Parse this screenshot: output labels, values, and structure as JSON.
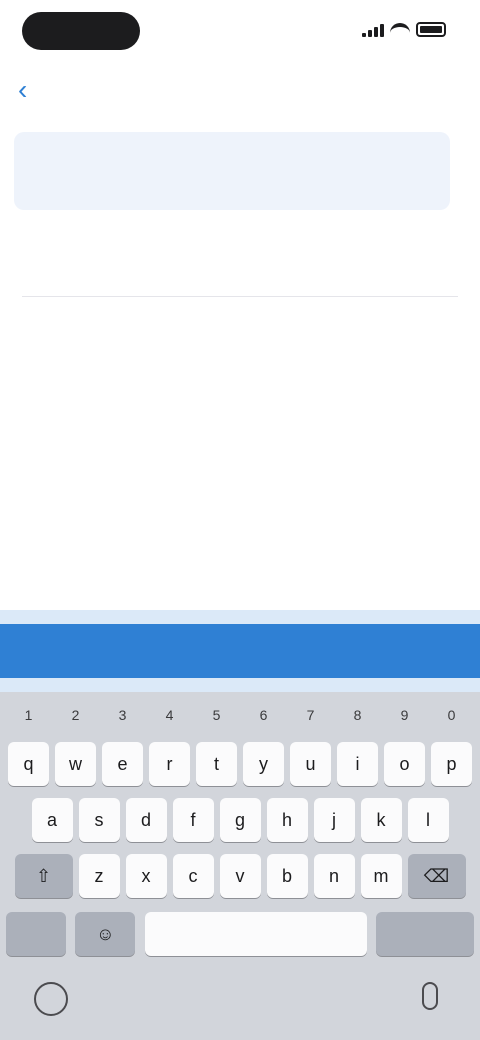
{
  "nav": {
    "back_icon": "chevron-left-icon",
    "title": ""
  },
  "form": {
    "header_label": "",
    "header_value": "",
    "input_value": "",
    "hint_text": ""
  },
  "action": {
    "label": ""
  },
  "keyboard": {
    "number_row": [
      "1",
      "2",
      "3",
      "4",
      "5",
      "6",
      "7",
      "8",
      "9",
      "0"
    ],
    "row1": [
      "q",
      "w",
      "e",
      "r",
      "t",
      "y",
      "u",
      "i",
      "o",
      "p"
    ],
    "row2": [
      "a",
      "s",
      "d",
      "f",
      "g",
      "h",
      "j",
      "k",
      "l"
    ],
    "row3": [
      "z",
      "x",
      "c",
      "v",
      "b",
      "n",
      "m"
    ],
    "shift_icon": "shift-icon",
    "delete_icon": "delete-icon",
    "numbers_label": "",
    "emoji_icon": "emoji-icon",
    "space_label": "",
    "return_label": "",
    "globe_icon": "globe-icon",
    "mic_icon": "microphone-icon"
  },
  "colors": {
    "accent": "#2f80d4",
    "keyboard_bg": "#d2d5db",
    "card_bg": "#eef3fb"
  }
}
